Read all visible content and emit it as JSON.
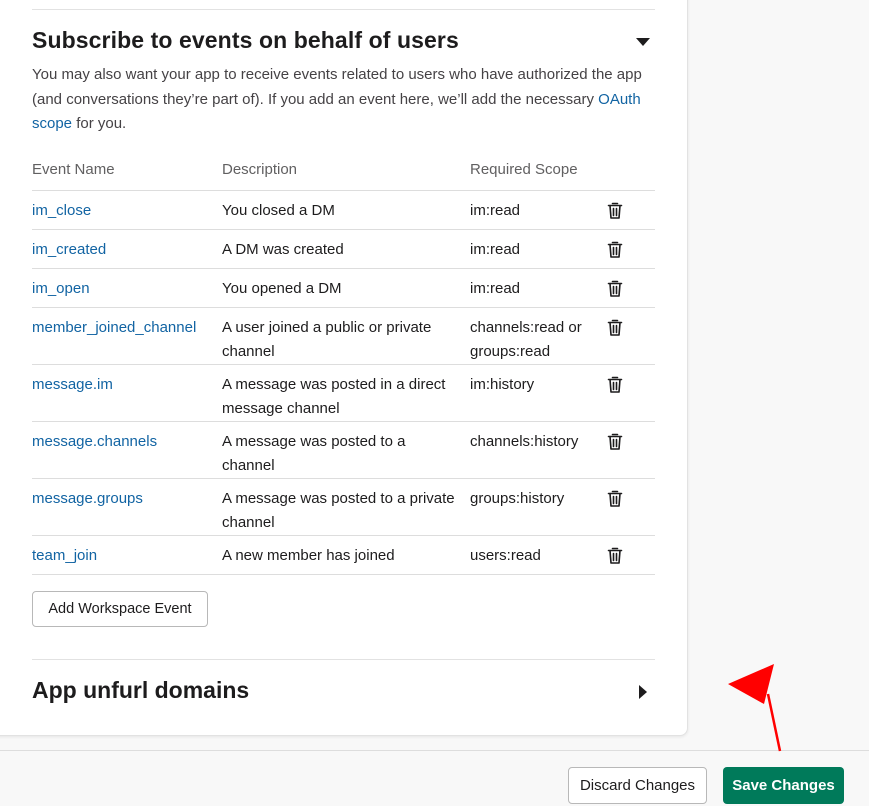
{
  "section": {
    "title": "Subscribe to events on behalf of users",
    "intro_before_link": "You may also want your app to receive events related to users who have authorized the app (and conversations they’re part of). If you add an event here, we’ll add the necessary ",
    "intro_link": "OAuth scope",
    "intro_after_link": " for you."
  },
  "table": {
    "headers": [
      "Event Name",
      "Description",
      "Required Scope"
    ],
    "rows": [
      {
        "name": "im_close",
        "description": "You closed a DM",
        "scope": "im:read"
      },
      {
        "name": "im_created",
        "description": "A DM was created",
        "scope": "im:read"
      },
      {
        "name": "im_open",
        "description": "You opened a DM",
        "scope": "im:read"
      },
      {
        "name": "member_joined_channel",
        "description": "A user joined a public or private channel",
        "scope": "channels:read or groups:read"
      },
      {
        "name": "message.im",
        "description": "A message was posted in a direct message channel",
        "scope": "im:history"
      },
      {
        "name": "message.channels",
        "description": "A message was posted to a channel",
        "scope": "channels:history"
      },
      {
        "name": "message.groups",
        "description": "A message was posted to a private channel",
        "scope": "groups:history"
      },
      {
        "name": "team_join",
        "description": "A new member has joined",
        "scope": "users:read"
      }
    ]
  },
  "add_button_label": "Add Workspace Event",
  "section2": {
    "title": "App unfurl domains"
  },
  "footer": {
    "discard_label": "Discard Changes",
    "save_label": "Save Changes"
  },
  "colors": {
    "link": "#1264a3",
    "save_button": "#007a5a",
    "annotation_arrow": "#ff0000"
  },
  "icons": [
    "chevron-down-icon",
    "trash-icon",
    "chevron-right-icon"
  ]
}
